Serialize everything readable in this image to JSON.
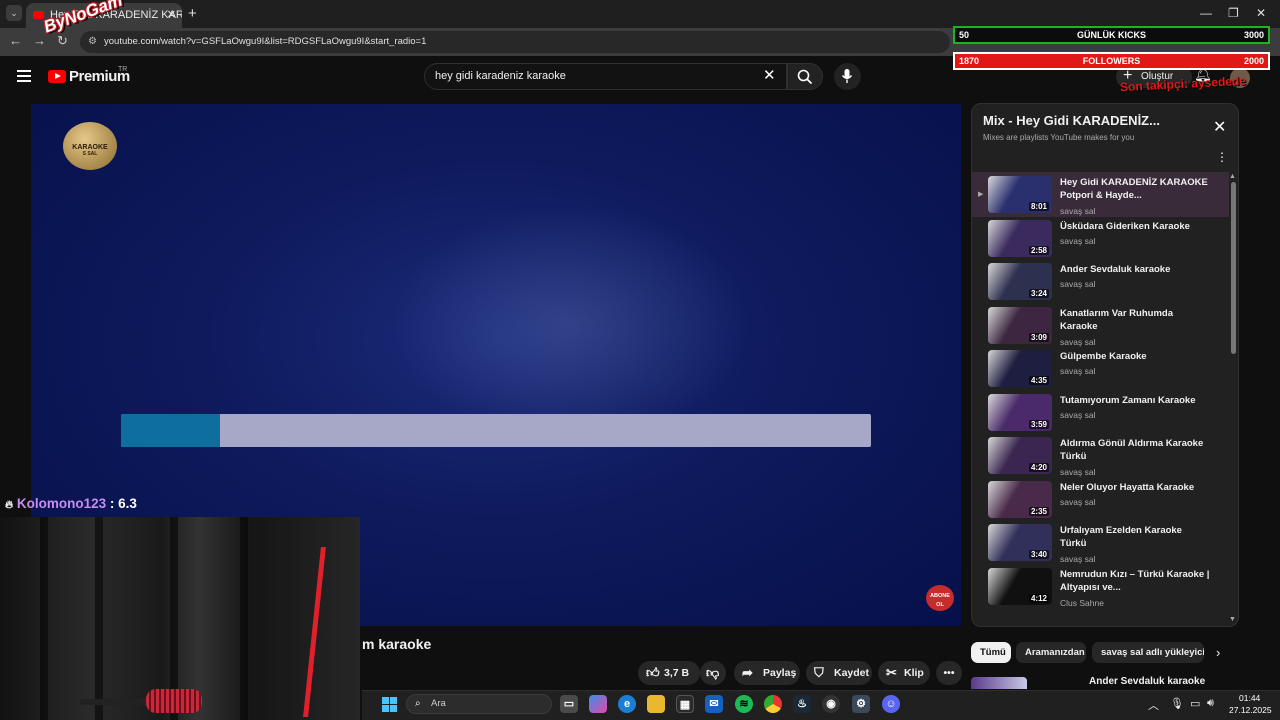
{
  "browser": {
    "tab_title": "Hey Gidi KARADENİZ KARAOKE",
    "url": "youtube.com/watch?v=GSFLaOwgu9I&list=RDGSFLaOwgu9I&start_radio=1"
  },
  "youtube": {
    "logo_text": "Premium",
    "country": "TR",
    "search_value": "hey gidi karadeniz karaoke",
    "create_label": "Oluştur"
  },
  "video": {
    "karaoke_logo": "KARAOKE",
    "karaoke_logo_sub": "S SAL",
    "progress_fraction": 0.132,
    "abone_badge": "ABONE OL",
    "title_partial": "m karaoke"
  },
  "actions": {
    "like_count": "3,7 B",
    "share_label": "Paylaş",
    "save_label": "Kaydet",
    "clip_label": "Klip"
  },
  "playlist": {
    "title": "Mix - Hey Gidi KARADENİZ...",
    "subtitle": "Mixes are playlists YouTube makes for you",
    "items": [
      {
        "title": "Hey Gidi KARADENİZ KARAOKE Potpori & Hayde...",
        "channel": "savaş sal",
        "duration": "8:01",
        "thumb_color": "#2a2f6e"
      },
      {
        "title": "Üsküdara Gideriken Karaoke",
        "channel": "savaş sal",
        "duration": "2:58",
        "thumb_color": "#3a2a5e"
      },
      {
        "title": "Ander Sevdaluk karaoke",
        "channel": "savaş sal",
        "duration": "3:24",
        "thumb_color": "#2e3050"
      },
      {
        "title": "Kanatlarım Var Ruhumda Karaoke",
        "channel": "savaş sal",
        "duration": "3:09",
        "thumb_color": "#3c2640"
      },
      {
        "title": "Gülpembe Karaoke",
        "channel": "savaş sal",
        "duration": "4:35",
        "thumb_color": "#1e1e40"
      },
      {
        "title": "Tutamıyorum Zamanı Karaoke",
        "channel": "savaş sal",
        "duration": "3:59",
        "thumb_color": "#4a2a6a"
      },
      {
        "title": "Aldırma Gönül Aldırma Karaoke Türkü",
        "channel": "savaş sal",
        "duration": "4:20",
        "thumb_color": "#3a2650"
      },
      {
        "title": "Neler Oluyor Hayatta Karaoke",
        "channel": "savaş sal",
        "duration": "2:35",
        "thumb_color": "#4a2a4a"
      },
      {
        "title": "Urfalıyam Ezelden Karaoke Türkü",
        "channel": "savaş sal",
        "duration": "3:40",
        "thumb_color": "#30305a"
      },
      {
        "title": "Nemrudun Kızı – Türkü Karaoke | Altyapısı ve...",
        "channel": "Clus Sahne",
        "duration": "4:12",
        "thumb_color": "#101010"
      }
    ]
  },
  "chips": [
    "Tümü",
    "Aramanızdan",
    "savaş sal adlı yükleyicid"
  ],
  "next_item_title": "Ander Sevdaluk karaoke",
  "overlay": {
    "stream_logo": "ByNoGam",
    "chat_user": "Kolomono123",
    "chat_score": ": 6.3",
    "goal_kicks": {
      "left": "50",
      "label": "GÜNLÜK KICKS",
      "right": "3000"
    },
    "goal_followers": {
      "left": "1870",
      "label": "FOLLOWERS",
      "right": "2000"
    },
    "last_follower": "Son takipçi: aysedede"
  },
  "taskbar": {
    "search_placeholder": "Ara",
    "time": "01:44",
    "date": "27.12.2025"
  },
  "colors": {
    "youtube_red": "#ff0000",
    "progress_fill": "#0e6f9e",
    "progress_track": "#a7a8c8",
    "goal_red": "#e01818",
    "goal_green": "#1fb31f",
    "chat_user": "#c78cf0"
  }
}
